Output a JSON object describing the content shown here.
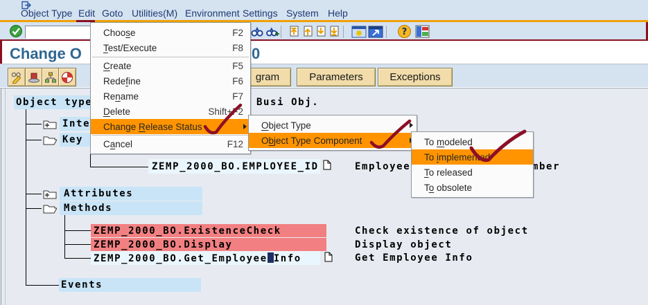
{
  "menu_bar": {
    "items": [
      "Object Type",
      "Edit",
      "Goto",
      "Utilities(M)",
      "Environment",
      "Settings",
      "System",
      "Help"
    ],
    "active_item": "Edit"
  },
  "toolbar": {
    "command_field": {
      "value": ""
    },
    "icons": [
      "enter",
      "find",
      "find-next",
      "first-page",
      "page-up",
      "page-down",
      "last-page",
      "new-session",
      "create-shortcut",
      "help",
      "customize-layout"
    ]
  },
  "title_bar": {
    "visible_left": "Change O",
    "visible_right": "0"
  },
  "app_toolbar": {
    "icon_buttons": [
      "display-change",
      "other-object",
      "object-hierarchy",
      "status-pie"
    ],
    "text_buttons": [
      {
        "label": "gram"
      },
      {
        "label": "Parameters"
      },
      {
        "label": "Exceptions"
      }
    ]
  },
  "edit_menu": {
    "items": [
      {
        "label": "Choose",
        "accel": 4,
        "shortcut": "F2"
      },
      {
        "label": "Test/Execute",
        "accel": 0,
        "shortcut": "F8"
      },
      {
        "label": "Create",
        "accel": 0,
        "shortcut": "F5"
      },
      {
        "label": "Redefine",
        "accel": 4,
        "shortcut": "F6"
      },
      {
        "label": "Rename",
        "accel": 2,
        "shortcut": "F7"
      },
      {
        "label": "Delete",
        "accel": 0,
        "shortcut": "Shift+F2"
      },
      {
        "label": "Change Release Status",
        "accel": 7,
        "shortcut": "",
        "highlighted": true,
        "has_submenu": true,
        "checked": true
      },
      {
        "label": "Cancel",
        "accel": 1,
        "shortcut": "F12"
      }
    ]
  },
  "object_submenu": {
    "items": [
      {
        "label": "Object Type",
        "accel": 0,
        "has_submenu": true
      },
      {
        "label": "Object Type Component",
        "accel": 1,
        "has_submenu": true,
        "highlighted": true,
        "checked": true
      }
    ]
  },
  "status_submenu": {
    "items": [
      {
        "label": "To modeled",
        "accel": 3
      },
      {
        "label": "To implemented",
        "accel": 3,
        "highlighted": true,
        "checked": true
      },
      {
        "label": "To released",
        "accel": 0
      },
      {
        "label": "To obsolete",
        "accel": 1
      }
    ]
  },
  "tree": {
    "root_label": "Object type",
    "root_right_label": "Busi Obj.",
    "nodes": {
      "interfaces_fragment": "Inte",
      "key": "Key",
      "attributes": "Attributes",
      "methods": "Methods",
      "events": "Events"
    },
    "key_field": {
      "name": "ZEMP_2000_BO.EMPLOYEE_ID",
      "desc_left": "Employee",
      "desc_right": "mber"
    },
    "methods": [
      {
        "name": "ZEMP_2000_BO.ExistenceCheck",
        "description": "Check existence of object",
        "status": "red"
      },
      {
        "name": "ZEMP_2000_BO.Display",
        "description": "Display object",
        "status": "red"
      },
      {
        "name_before_cursor": "ZEMP_2000_BO.Get_Employee",
        "name_after_cursor": "Info",
        "description": "Get Employee Info",
        "status": "normal"
      }
    ]
  },
  "colors": {
    "menu_highlight": "#ff9400",
    "selection_blue": "#c9e4f7",
    "error_red": "#f28082",
    "annotation_maroon": "#8c0f26",
    "title_blue": "#2f6791",
    "toolbar_bg": "#d5e2f0",
    "content_bg": "#e7ebf1",
    "button_tan": "#f1dcaa",
    "orange_rule": "#f0a000"
  }
}
